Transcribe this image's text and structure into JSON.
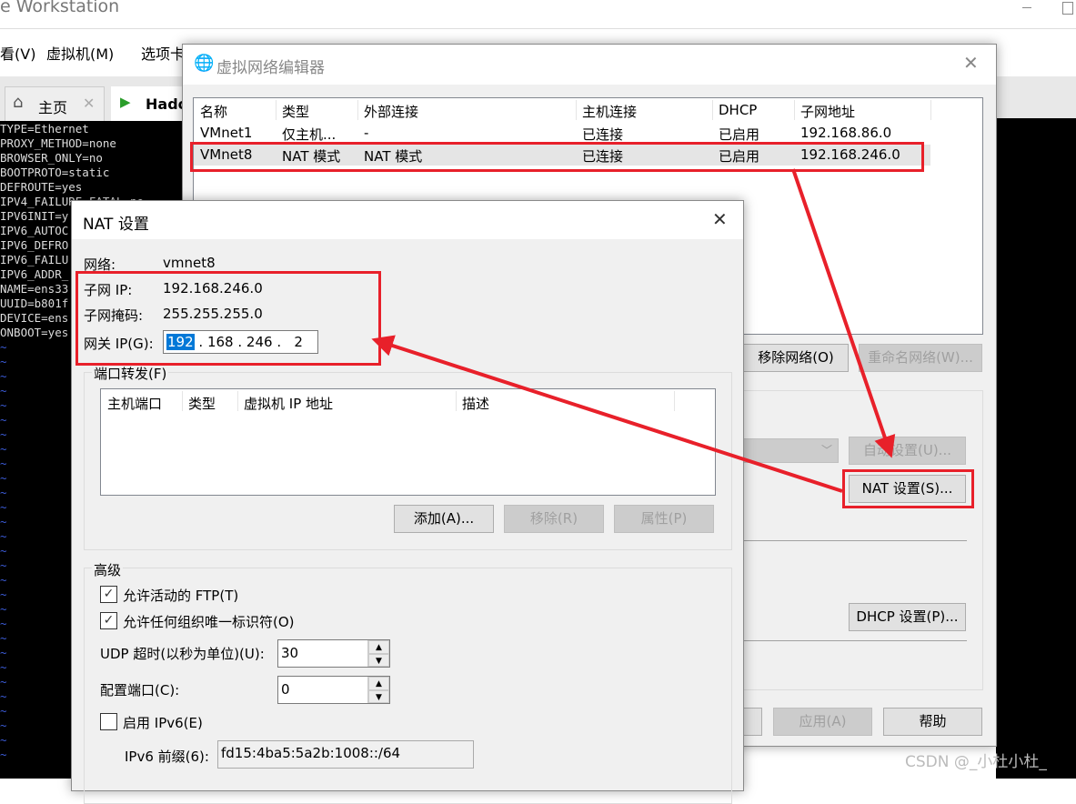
{
  "app": {
    "title": "e Workstation",
    "menu": [
      "看(V)",
      "虚拟机(M)",
      "选项卡"
    ],
    "tabs": [
      {
        "label": "主页",
        "icon": "home-icon"
      },
      {
        "label": "Hado",
        "icon": "vm-play-icon"
      }
    ]
  },
  "terminal": {
    "lines": [
      "TYPE=Ethernet",
      "PROXY_METHOD=none",
      "BROWSER_ONLY=no",
      "BOOTPROTO=static",
      "DEFROUTE=yes",
      "IPV4_FAILURE_FATAL=no",
      "IPV6INIT=y",
      "IPV6_AUTOC",
      "IPV6_DEFRO",
      "IPV6_FAILU",
      "IPV6_ADDR_",
      "NAME=ens33",
      "UUID=b801f",
      "DEVICE=ens",
      "ONBOOT=yes"
    ],
    "tilde": "~"
  },
  "vne": {
    "title": "虚拟网络编辑器",
    "columns": [
      "名称",
      "类型",
      "外部连接",
      "主机连接",
      "DHCP",
      "子网地址"
    ],
    "rows": [
      [
        "VMnet1",
        "仅主机...",
        "-",
        "已连接",
        "已启用",
        "192.168.86.0"
      ],
      [
        "VMnet8",
        "NAT 模式",
        "NAT 模式",
        "已连接",
        "已启用",
        "192.168.246.0"
      ]
    ],
    "remove_network": "移除网络(O)",
    "rename_network": "重命名网络(W)...",
    "auto_settings": "自动设置(U)...",
    "nat_settings": "NAT 设置(S)...",
    "dhcp_settings": "DHCP 设置(P)...",
    "apply": "应用(A)",
    "help": "帮助"
  },
  "nat": {
    "title": "NAT 设置",
    "network_label": "网络:",
    "network": "vmnet8",
    "subnet_ip_label": "子网 IP:",
    "subnet_ip": "192.168.246.0",
    "subnet_mask_label": "子网掩码:",
    "subnet_mask": "255.255.255.0",
    "gateway_label": "网关 IP(G):",
    "gateway": [
      "192",
      "168",
      "246",
      "2"
    ],
    "port_forward": {
      "title": "端口转发(F)",
      "columns": [
        "主机端口",
        "类型",
        "虚拟机 IP 地址",
        "描述"
      ],
      "add": "添加(A)...",
      "remove": "移除(R)",
      "properties": "属性(P)"
    },
    "advanced": {
      "title": "高级",
      "allow_ftp": "允许活动的 FTP(T)",
      "allow_ftp_checked": true,
      "allow_oui": "允许任何组织唯一标识符(O)",
      "allow_oui_checked": true,
      "udp_label": "UDP 超时(以秒为单位)(U):",
      "udp": "30",
      "config_port_label": "配置端口(C):",
      "config_port": "0",
      "ipv6_label": "启用 IPv6(E)",
      "ipv6_checked": false,
      "ipv6_prefix_label": "IPv6 前缀(6):",
      "ipv6_prefix": "fd15:4ba5:5a2b:1008::/64"
    }
  },
  "watermark": "CSDN @_小杜小杜_",
  "colors": {
    "annotation": "#e8202a",
    "selection": "#0078d7"
  }
}
